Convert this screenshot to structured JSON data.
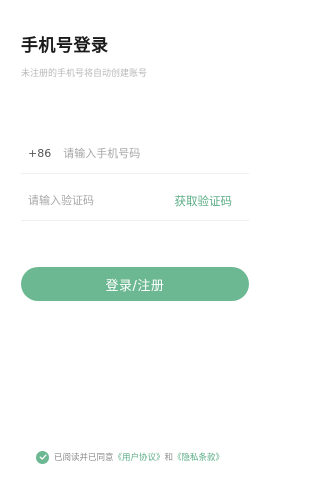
{
  "header": {
    "title": "手机号登录",
    "subtitle": "未注册的手机号将自动创建账号"
  },
  "phone": {
    "prefix": "+86",
    "placeholder": "请输入手机号码",
    "value": ""
  },
  "code": {
    "placeholder": "请输入验证码",
    "value": "",
    "get_code_label": "获取验证码"
  },
  "submit": {
    "label": "登录/注册"
  },
  "agreement": {
    "checked": true,
    "prefix_text": "已阅读并已同意",
    "user_agreement": "《用户协议》",
    "and_text": "和",
    "privacy_policy": "《隐私条款》"
  },
  "colors": {
    "accent": "#6cb892",
    "link": "#5cae86"
  }
}
